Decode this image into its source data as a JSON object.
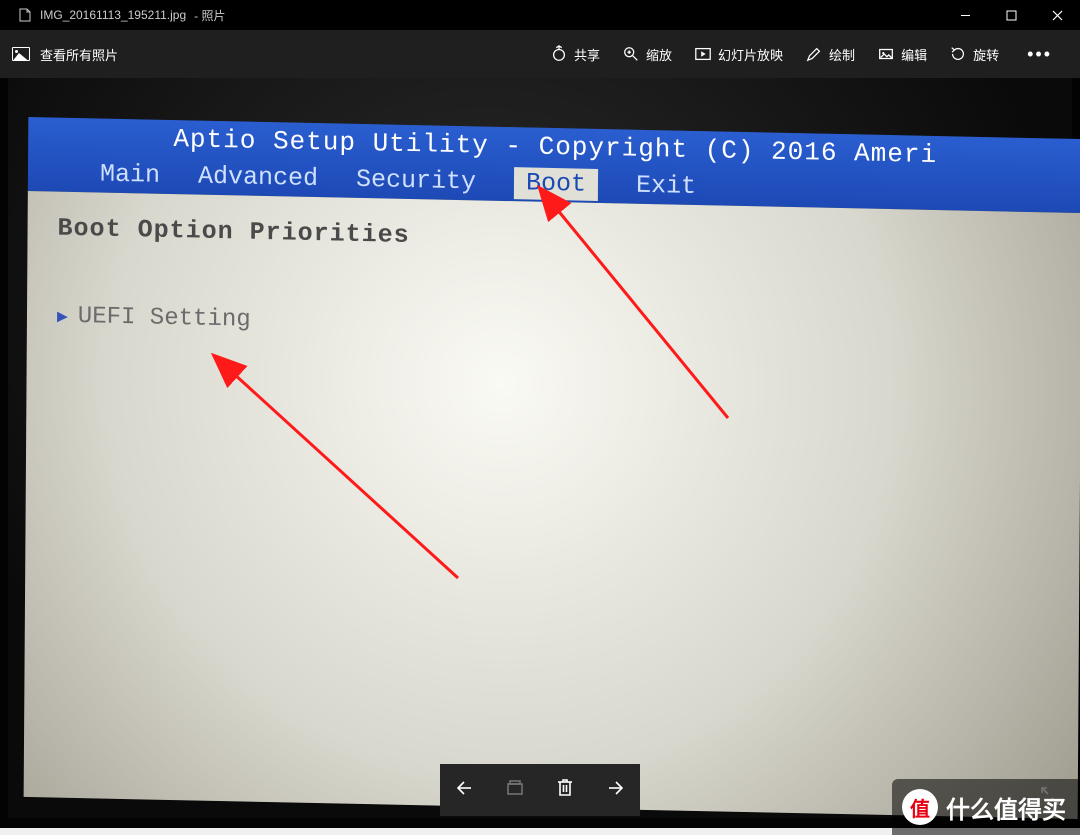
{
  "window": {
    "filename": "IMG_20161113_195211.jpg",
    "app_suffix": " - 照片"
  },
  "commandbar": {
    "view_all": "查看所有照片",
    "share": "共享",
    "zoom": "缩放",
    "slideshow": "幻灯片放映",
    "draw": "绘制",
    "edit": "编辑",
    "rotate": "旋转"
  },
  "bios": {
    "title": "Aptio Setup Utility - Copyright (C) 2016 Ameri",
    "tabs": [
      "Main",
      "Advanced",
      "Security",
      "Boot",
      "Exit"
    ],
    "active_tab_index": 3,
    "section_heading": "Boot Option Priorities",
    "option": "UEFI Setting"
  },
  "watermark": {
    "badge_char": "值",
    "text": "什么值得买"
  }
}
